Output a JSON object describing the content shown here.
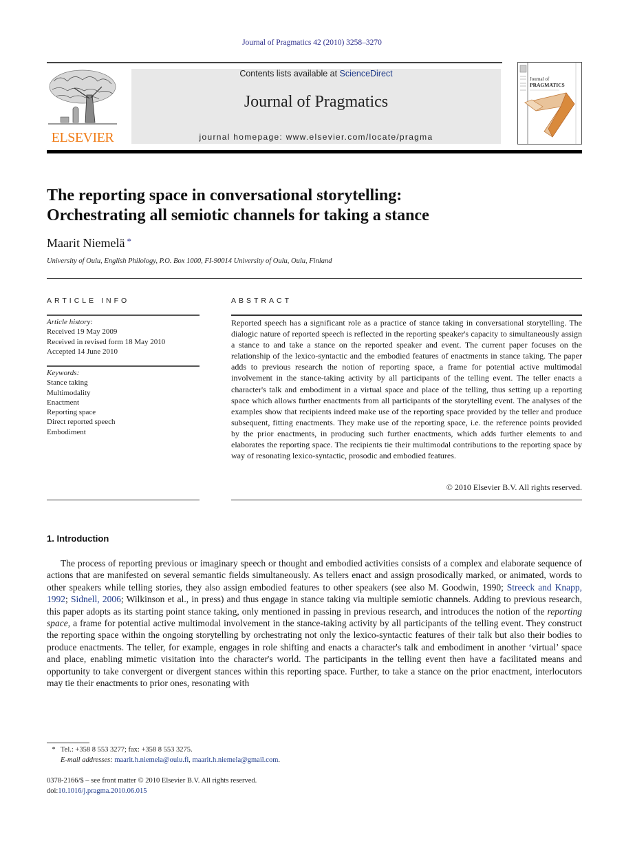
{
  "running_head": "Journal of Pragmatics 42 (2010) 3258–3270",
  "masthead": {
    "publisher_logo_text": "ELSEVIER",
    "contents_prefix": "Contents lists available at ",
    "contents_link": "ScienceDirect",
    "journal_name": "Journal of Pragmatics",
    "homepage": "journal homepage: www.elsevier.com/locate/pragma",
    "cover_title_line1": "Journal of",
    "cover_title_line2": "PRAGMATICS"
  },
  "article": {
    "title_line1": "The reporting space in conversational storytelling:",
    "title_line2": "Orchestrating all semiotic channels for taking a stance",
    "author": "Maarit Niemelä",
    "author_mark": "*",
    "affiliation": "University of Oulu, English Philology, P.O. Box 1000, FI-90014 University of Oulu, Oulu, Finland"
  },
  "article_info": {
    "heading": "ARTICLE INFO",
    "history_label": "Article history:",
    "history": [
      "Received 19 May 2009",
      "Received in revised form 18 May 2010",
      "Accepted 14 June 2010"
    ],
    "keywords_label": "Keywords:",
    "keywords": [
      "Stance taking",
      "Multimodality",
      "Enactment",
      "Reporting space",
      "Direct reported speech",
      "Embodiment"
    ]
  },
  "abstract": {
    "heading": "ABSTRACT",
    "text": "Reported speech has a significant role as a practice of stance taking in conversational storytelling. The dialogic nature of reported speech is reflected in the reporting speaker's capacity to simultaneously assign a stance to and take a stance on the reported speaker and event. The current paper focuses on the relationship of the lexico-syntactic and the embodied features of enactments in stance taking. The paper adds to previous research the notion of reporting space, a frame for potential active multimodal involvement in the stance-taking activity by all participants of the telling event. The teller enacts a character's talk and embodiment in a virtual space and place of the telling, thus setting up a reporting space which allows further enactments from all participants of the storytelling event. The analyses of the examples show that recipients indeed make use of the reporting space provided by the teller and produce subsequent, fitting enactments. They make use of the reporting space, i.e. the reference points provided by the prior enactments, in producing such further enactments, which adds further elements to and elaborates the reporting space. The recipients tie their multimodal contributions to the reporting space by way of resonating lexico-syntactic, prosodic and embodied features.",
    "copyright": "© 2010 Elsevier B.V. All rights reserved."
  },
  "introduction": {
    "heading": "1.  Introduction",
    "p1": "The process of reporting previous or imaginary speech or thought and embodied activities consists of a complex and elaborate sequence of actions that are manifested on several semantic fields simultaneously. As tellers enact and assign prosodically marked, or animated, words to other speakers while telling stories, they also assign embodied features to other speakers (see also M. Goodwin, 1990; ",
    "cite1": "Streeck and Knapp, 1992",
    "sep1": "; ",
    "cite2": "Sidnell, 2006",
    "p2": "; Wilkinson et al., in press) and thus engage in stance taking via multiple semiotic channels. Adding to previous research, this paper adopts as its starting point stance taking, only mentioned in passing in previous research, and introduces the notion of the ",
    "term": "reporting space",
    "p3": ", a frame for potential active multimodal involvement in the stance-taking activity by all participants of the telling event. They construct the reporting space within the ongoing storytelling by orchestrating not only the lexico-syntactic features of their talk but also their bodies to produce enactments. The teller, for example, engages in role shifting and enacts a character's talk and embodiment in another ‘virtual’ space and place, enabling mimetic visitation into the character's world. The participants in the telling event then have a facilitated means and opportunity to take convergent or divergent stances within this reporting space. Further, to take a stance on the prior enactment, interlocutors may tie their enactments to prior ones, resonating with"
  },
  "footnotes": {
    "mark": "*",
    "contact": "Tel.: +358 8 553 3277; fax: +358 8 553 3275.",
    "email_label": "E-mail addresses:",
    "email1": "maarit.h.niemela@oulu.fi",
    "email_sep": ", ",
    "email2": "maarit.h.niemela@gmail.com",
    "email_end": ".",
    "front_matter": "0378-2166/$ – see front matter © 2010 Elsevier B.V. All rights reserved.",
    "doi_label": "doi:",
    "doi": "10.1016/j.pragma.2010.06.015"
  }
}
